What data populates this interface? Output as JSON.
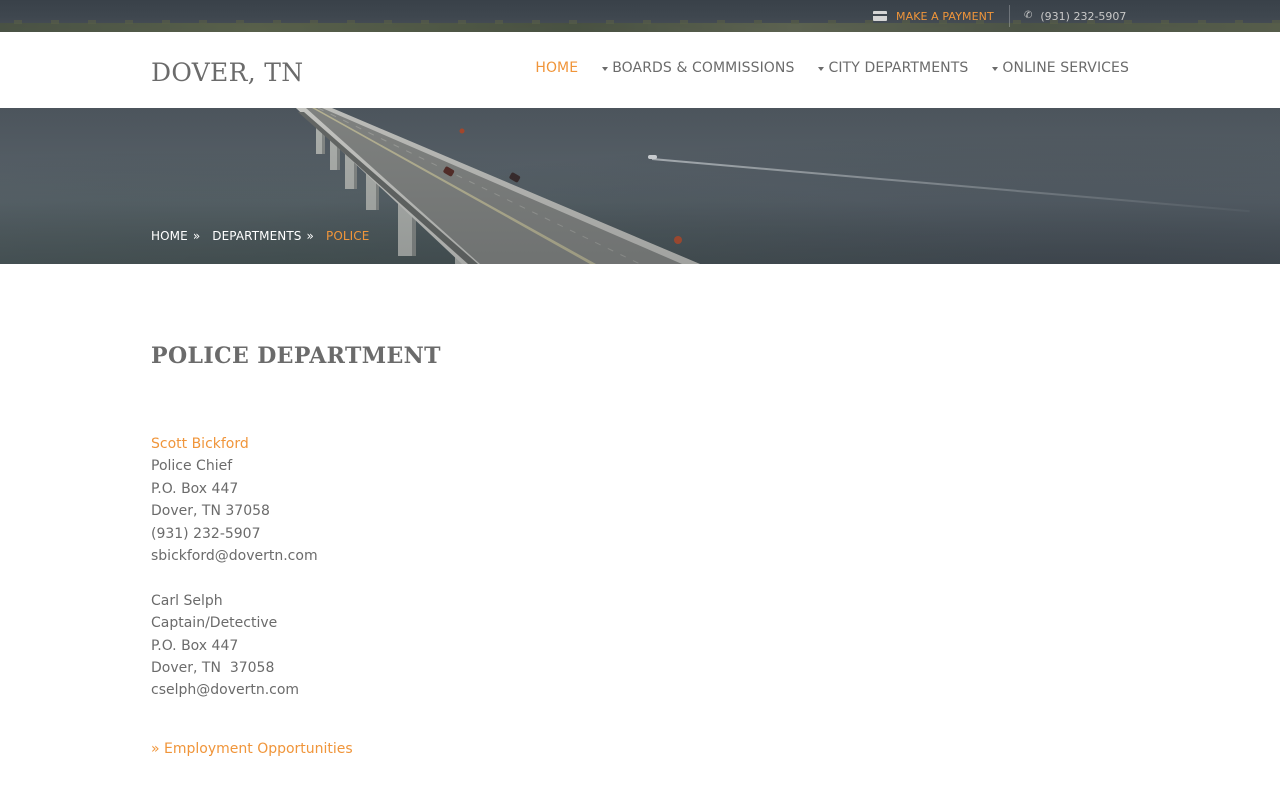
{
  "topbar": {
    "payment_label": "MAKE A PAYMENT",
    "phone_label": "(931) 232-5907",
    "payment_icon": "credit-card-icon",
    "phone_icon": "phone-icon"
  },
  "header": {
    "logo": "DOVER, TN",
    "nav": [
      {
        "label": "HOME",
        "active": true,
        "has_dropdown": false
      },
      {
        "label": "BOARDS & COMMISSIONS",
        "active": false,
        "has_dropdown": true
      },
      {
        "label": "CITY DEPARTMENTS",
        "active": false,
        "has_dropdown": true
      },
      {
        "label": "ONLINE SERVICES",
        "active": false,
        "has_dropdown": true
      }
    ]
  },
  "breadcrumb": {
    "items": [
      "HOME",
      "DEPARTMENTS",
      "POLICE"
    ],
    "separator": "»"
  },
  "main": {
    "title": "POLICE DEPARTMENT",
    "contacts": [
      {
        "name": "Scott Bickford",
        "name_is_link": true,
        "title": "Police Chief",
        "address": "P.O. Box 447",
        "city": "Dover, TN 37058",
        "phone": "(931) 232-5907",
        "email": "sbickford@dovertn.com"
      },
      {
        "name": "Carl Selph",
        "name_is_link": false,
        "title": "Captain/Detective",
        "address": "P.O. Box 447",
        "city": "Dover, TN  37058",
        "email": "cselph@dovertn.com"
      }
    ],
    "employment_link": "» Employment Opportunities"
  },
  "colors": {
    "accent": "#f0953a",
    "text": "#6b6b6b",
    "topbar_bg": "#3f474f"
  }
}
